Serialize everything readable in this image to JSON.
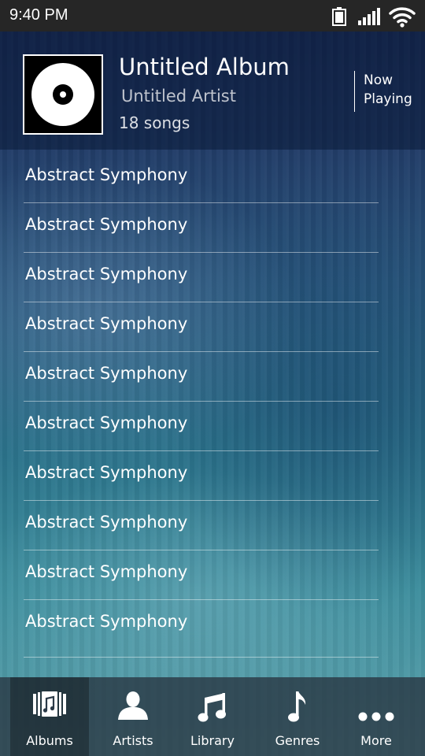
{
  "status_bar": {
    "time": "9:40 PM",
    "icons": [
      "battery-icon",
      "signal-icon",
      "wifi-icon"
    ]
  },
  "album": {
    "title": "Untitled Album",
    "artist": "Untitled Artist",
    "song_count": "18 songs",
    "art_icon": "disc-icon"
  },
  "now_playing": {
    "line1": "Now",
    "line2": "Playing"
  },
  "songs": [
    "Abstract Symphony",
    "Abstract Symphony",
    "Abstract Symphony",
    "Abstract Symphony",
    "Abstract Symphony",
    "Abstract Symphony",
    "Abstract Symphony",
    "Abstract Symphony",
    "Abstract Symphony",
    "Abstract Symphony"
  ],
  "tabs": [
    {
      "label": "Albums",
      "icon": "albums-icon",
      "active": true
    },
    {
      "label": "Artists",
      "icon": "artist-icon",
      "active": false
    },
    {
      "label": "Library",
      "icon": "music-notes-icon",
      "active": false
    },
    {
      "label": "Genres",
      "icon": "music-note-icon",
      "active": false
    },
    {
      "label": "More",
      "icon": "more-dots-icon",
      "active": false
    }
  ],
  "colors": {
    "status_bar_bg": "#262626",
    "text": "#ffffff",
    "background_top": "#1a2a58",
    "background_bottom": "#5fa2ac"
  }
}
